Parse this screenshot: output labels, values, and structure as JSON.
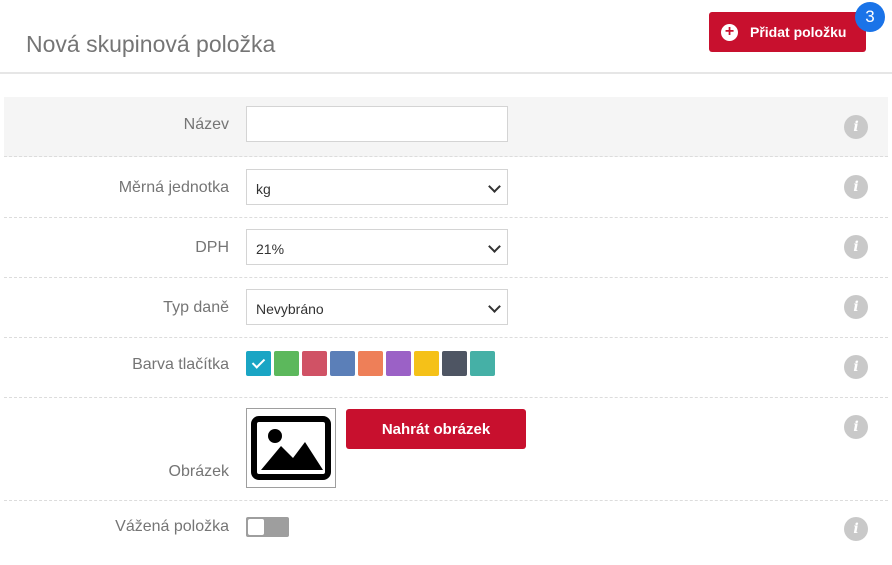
{
  "header": {
    "title": "Nová skupinová položka",
    "add_button_label": "Přidat položku",
    "badge_count": "3",
    "accent_color": "#c8102e",
    "badge_color": "#1a73e8"
  },
  "form": {
    "name": {
      "label": "Název",
      "value": ""
    },
    "unit": {
      "label": "Měrná jednotka",
      "value": "kg"
    },
    "vat": {
      "label": "DPH",
      "value": "21%"
    },
    "tax_type": {
      "label": "Typ daně",
      "value": "Nevybráno"
    },
    "button_color": {
      "label": "Barva tlačítka",
      "selected_index": 0,
      "colors": [
        "#1aa5c4",
        "#5cb85c",
        "#d05265",
        "#5b7fb8",
        "#ee7f58",
        "#9b61c6",
        "#f5c118",
        "#4e5563",
        "#45b0a6"
      ]
    },
    "image": {
      "label": "Obrázek",
      "upload_label": "Nahrát obrázek",
      "icon": "image-icon"
    },
    "weighted": {
      "label": "Vážená položka",
      "enabled": false
    }
  },
  "info_icon": "info-icon"
}
